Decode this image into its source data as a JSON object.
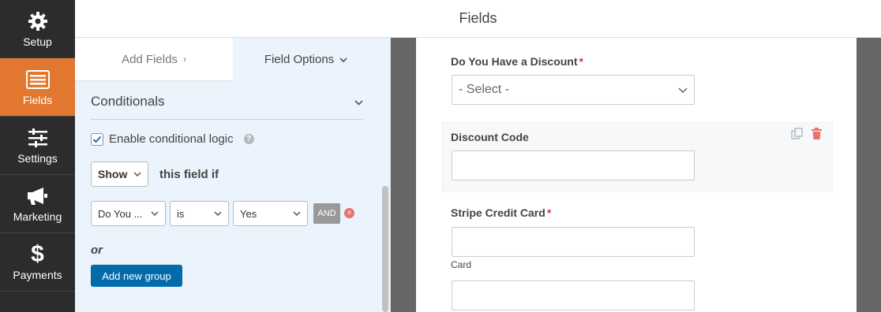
{
  "sidebar": {
    "items": [
      {
        "label": "Setup",
        "icon": "gear-icon"
      },
      {
        "label": "Fields",
        "icon": "list-icon",
        "active": true
      },
      {
        "label": "Settings",
        "icon": "sliders-icon"
      },
      {
        "label": "Marketing",
        "icon": "megaphone-icon"
      },
      {
        "label": "Payments",
        "icon": "dollar-icon"
      }
    ]
  },
  "header": {
    "title": "Fields"
  },
  "tabs": {
    "add_fields": "Add Fields",
    "field_options": "Field Options"
  },
  "conditionals": {
    "title": "Conditionals",
    "enable_label": "Enable conditional logic",
    "enable_checked": true,
    "help": "?",
    "show_value": "Show",
    "this_field_if": "this field if",
    "rule": {
      "field": "Do You ...",
      "operator": "is",
      "value": "Yes",
      "and": "AND",
      "remove": "×"
    },
    "or_label": "or",
    "add_group": "Add new group"
  },
  "form": {
    "discount_question": {
      "label": "Do You Have a Discount",
      "required": "*",
      "placeholder": "- Select -"
    },
    "discount_code": {
      "label": "Discount Code"
    },
    "stripe": {
      "label": "Stripe Credit Card",
      "required": "*",
      "sublabel": "Card"
    }
  },
  "colors": {
    "accent": "#e27730",
    "primary_button": "#036aab",
    "sidebar_bg": "#2c2c2c",
    "panel_bg": "#ebf3fc"
  }
}
